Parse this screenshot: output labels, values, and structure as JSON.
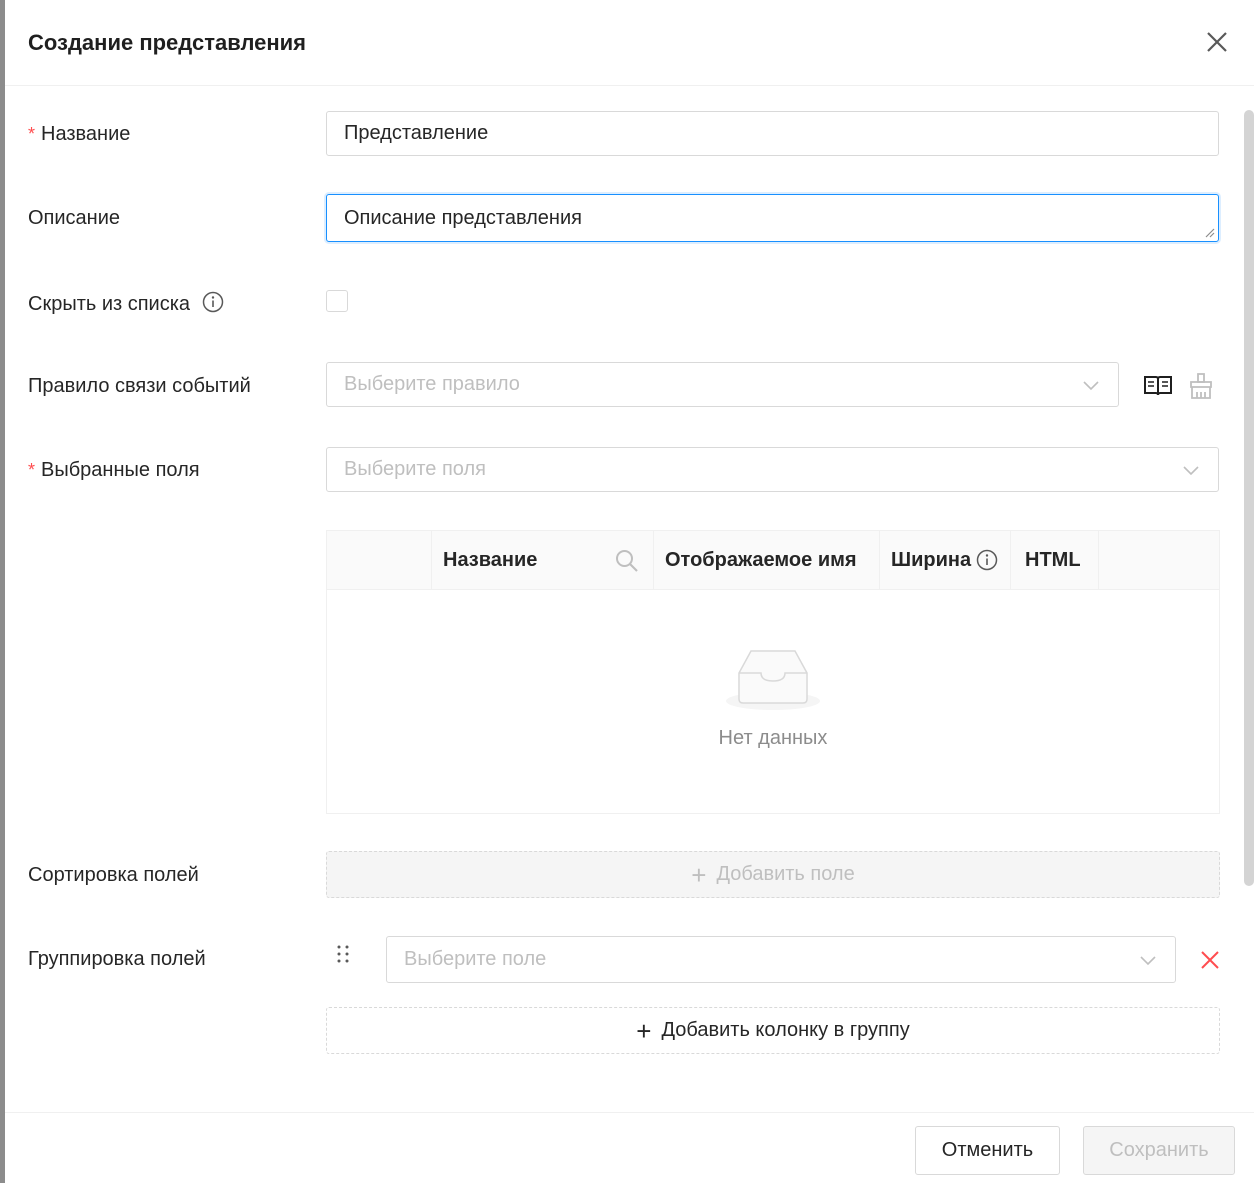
{
  "modal": {
    "title": "Создание представления"
  },
  "form": {
    "name": {
      "label": "Название",
      "required": true,
      "value": "Представление"
    },
    "description": {
      "label": "Описание",
      "value": "Описание представления"
    },
    "hide": {
      "label": "Скрыть из списка",
      "checked": false
    },
    "event_rule": {
      "label": "Правило связи событий",
      "placeholder": "Выберите правило"
    },
    "selected_fields": {
      "label": "Выбранные поля",
      "required": true,
      "placeholder": "Выберите поля"
    },
    "fields_table": {
      "columns": [
        "Название",
        "Отображаемое имя",
        "Ширина",
        "HTML"
      ],
      "empty_text": "Нет данных"
    },
    "sort": {
      "label": "Сортировка полей",
      "add_label": "Добавить поле"
    },
    "group": {
      "label": "Группировка полей",
      "placeholder": "Выберите поле",
      "add_label": "Добавить колонку в группу"
    }
  },
  "footer": {
    "cancel_label": "Отменить",
    "save_label": "Сохранить"
  },
  "icons": {
    "close": "close-icon",
    "info": "info-icon",
    "book": "book-icon",
    "clear": "broom-icon",
    "search": "search-icon",
    "drag": "drag-handle-icon",
    "delete": "delete-icon",
    "empty": "empty-inbox-icon"
  },
  "colors": {
    "required": "#ff4d4f",
    "focus": "#1890ff",
    "delete": "#ff4d4f",
    "placeholder": "#bfbfbf"
  }
}
